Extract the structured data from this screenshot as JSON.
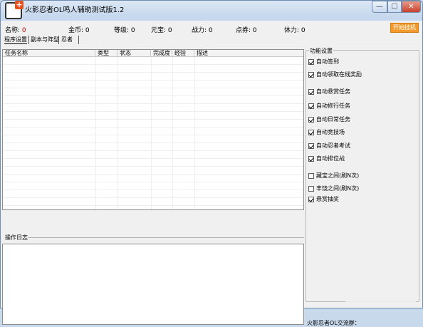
{
  "window": {
    "title": "火影忍者OL鸣人辅助测试版1.2",
    "controls": {
      "minimize": "—",
      "maximize": "☐",
      "close": "✕"
    }
  },
  "status": {
    "name_label": "名称:",
    "name_value": "0",
    "gold_label": "金币:",
    "gold_value": "0",
    "level_label": "等级:",
    "level_value": "0",
    "yuanbao_label": "元宝:",
    "yuanbao_value": "0",
    "power_label": "战力:",
    "power_value": "0",
    "points_label": "点券:",
    "points_value": "0",
    "stamina_label": "体力:",
    "stamina_value": "0",
    "start_button": "开始挂机"
  },
  "tabs": [
    "程序设置",
    "副本与阵型",
    "忍者"
  ],
  "task_table": {
    "columns": [
      "任务名称",
      "类型",
      "状态",
      "完成度",
      "经验",
      "描述"
    ],
    "rows": []
  },
  "log": {
    "label": "操作日志",
    "content": ""
  },
  "features": {
    "group_title": "功能设置",
    "items": [
      {
        "label": "自动签到",
        "checked": true
      },
      {
        "label": "自动领取在线奖励",
        "checked": true
      },
      {
        "label": "自动悬赏任务",
        "checked": true
      },
      {
        "label": "自动修行任务",
        "checked": true
      },
      {
        "label": "自动日常任务",
        "checked": true
      },
      {
        "label": "自动竞技场",
        "checked": true
      },
      {
        "label": "自动忍者考试",
        "checked": true
      },
      {
        "label": "自动排位战",
        "checked": true
      },
      {
        "label": "藏宝之间(刷N次)",
        "checked": false
      },
      {
        "label": "丰饶之间(刷N次)",
        "checked": false
      },
      {
        "label": "悬赏抽奖",
        "checked": true
      }
    ],
    "footer": "火影忍者OL交流群："
  },
  "colors": {
    "accent": "#f39a2c",
    "value_red": "#d00000"
  },
  "icons": {
    "app": "app-plus-icon"
  }
}
